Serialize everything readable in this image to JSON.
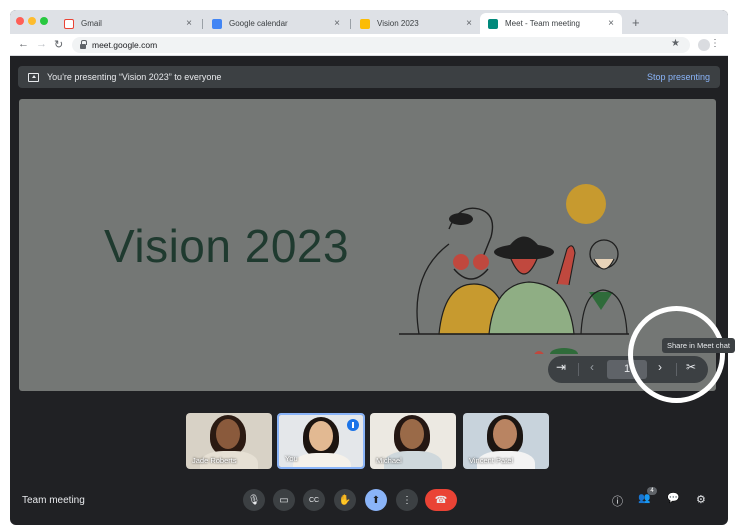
{
  "browser": {
    "tabs": [
      {
        "title": "Gmail",
        "active": false
      },
      {
        "title": "Google calendar",
        "active": false
      },
      {
        "title": "Vision 2023",
        "active": false
      },
      {
        "title": "Meet - Team meeting",
        "active": true
      }
    ],
    "close_glyph": "×",
    "new_tab_glyph": "+",
    "url": "meet.google.com",
    "back_glyph": "←",
    "forward_glyph": "→",
    "reload_glyph": "↻",
    "star_glyph": "★",
    "menu_glyph": "⋮"
  },
  "banner": {
    "message": "You're presenting “Vision 2023” to everyone",
    "stop_label": "Stop presenting"
  },
  "slide": {
    "title": "Vision 2023",
    "page": "1"
  },
  "slide_controls": {
    "exit_glyph": "⇥",
    "prev_glyph": "‹",
    "next_glyph": "›",
    "share_glyph": "✂"
  },
  "tooltip": "Share in Meet chat",
  "participants": [
    {
      "name": "Jade Roberts",
      "speaking": false
    },
    {
      "name": "You",
      "speaking": true
    },
    {
      "name": "Michael",
      "speaking": false
    },
    {
      "name": "Vincent Patel",
      "speaking": false
    }
  ],
  "bottom_bar": {
    "meeting_name": "Team meeting",
    "people_count": "4",
    "icons": {
      "mic": "🎙",
      "camera": "▭",
      "captions": "CC",
      "hand": "✋",
      "present": "⬆",
      "more": "⋮",
      "hangup": "☎",
      "info": "ⓘ",
      "people": "👥",
      "chat": "💬",
      "activities": "⚙"
    }
  },
  "colors": {
    "accent_blue": "#8ab4f8",
    "hangup_red": "#ea4335",
    "meet_bg": "#202124"
  }
}
